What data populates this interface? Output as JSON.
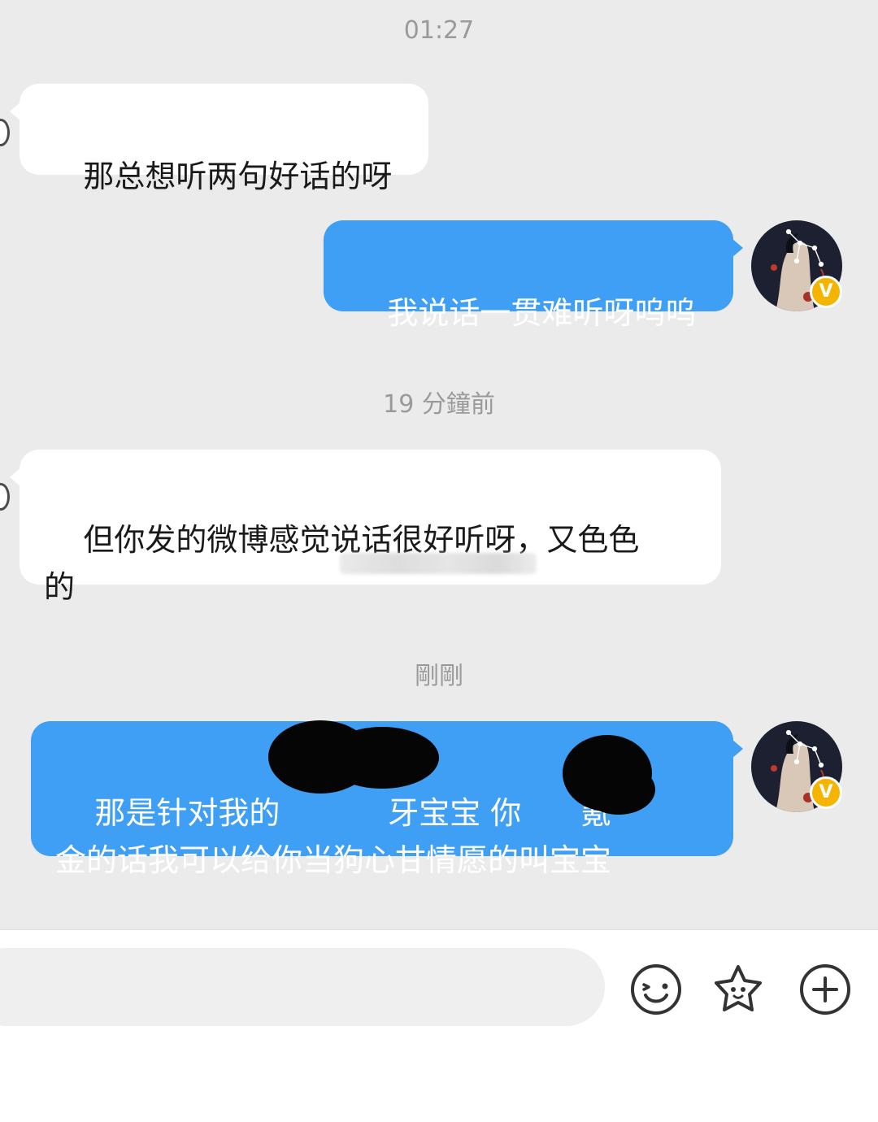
{
  "timestamps": [
    "01:27",
    "19 分鐘前",
    "剛剛"
  ],
  "messages": [
    {
      "side": "in",
      "text": "那总想听两句好话的呀"
    },
    {
      "side": "out",
      "text": "我说话一贯难听呀呜呜"
    },
    {
      "side": "in",
      "text": "但你发的微博感觉说话很好听呀，又色色\n的"
    },
    {
      "side": "out",
      "text": "那是针对我的           牙宝宝 你      氪\n金的话我可以给你当狗心甘情愿的叫宝宝"
    }
  ],
  "composer": {
    "value": "",
    "placeholder": ""
  },
  "icons": {
    "emoji": "smiley-icon",
    "sticker": "star-face-icon",
    "more": "plus-circle-icon"
  },
  "colors": {
    "outgoing": "#3e9ff4",
    "incoming": "#ffffff",
    "background": "#ebebeb",
    "badge": "#f5b400"
  },
  "badge": "V"
}
